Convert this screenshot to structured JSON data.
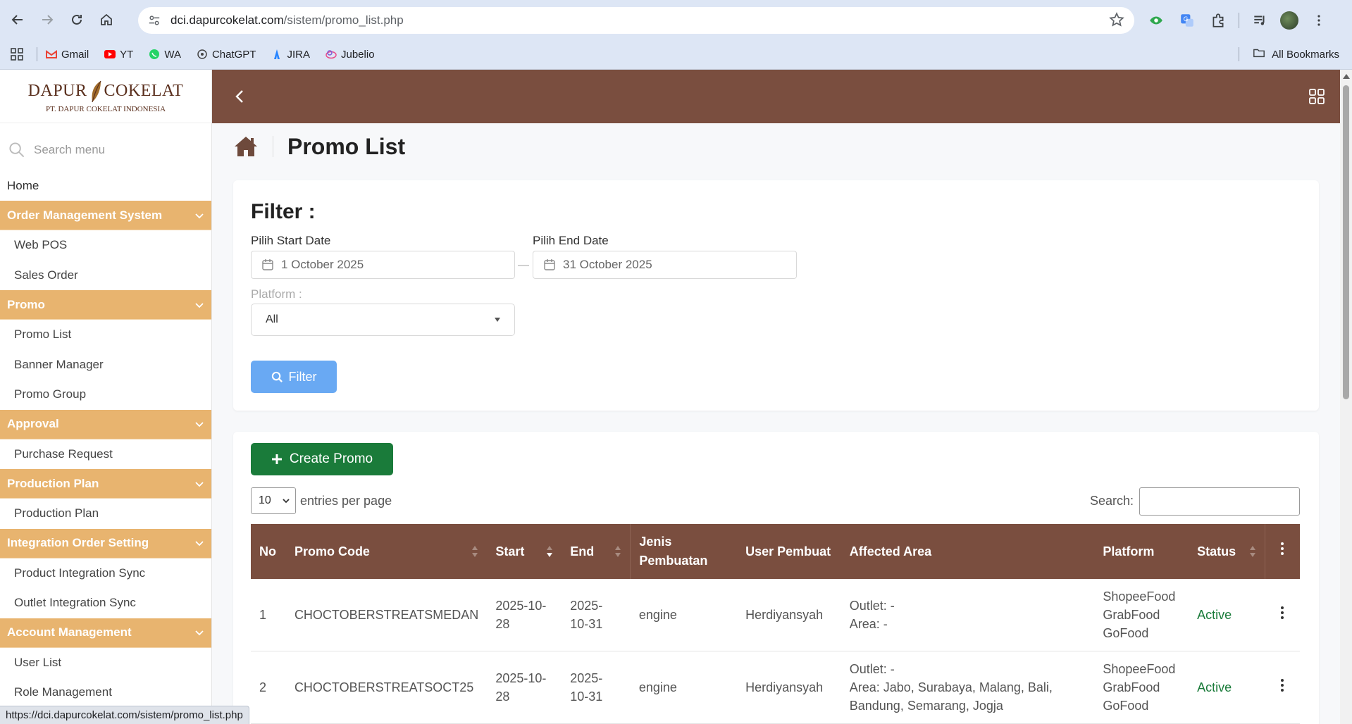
{
  "browser": {
    "url_host": "dci.dapurcokelat.com",
    "url_path": "/sistem/promo_list.php",
    "bookmarks": [
      {
        "label": "Gmail",
        "icon": "gmail-icon",
        "color": "#ea4335"
      },
      {
        "label": "YT",
        "icon": "youtube-icon",
        "color": "#ff0000"
      },
      {
        "label": "WA",
        "icon": "whatsapp-icon",
        "color": "#25d366"
      },
      {
        "label": "ChatGPT",
        "icon": "chatgpt-icon",
        "color": "#444444"
      },
      {
        "label": "JIRA",
        "icon": "jira-icon",
        "color": "#2684ff"
      },
      {
        "label": "Jubelio",
        "icon": "jubelio-icon",
        "color": "#e94b8a"
      }
    ],
    "all_bookmarks": "All Bookmarks",
    "status_url": "https://dci.dapurcokelat.com/sistem/promo_list.php"
  },
  "logo": {
    "name_left": "DAPUR",
    "name_right": "COKELAT",
    "subtitle": "PT. DAPUR COKELAT INDONESIA"
  },
  "sidebar": {
    "search_placeholder": "Search menu",
    "home": "Home",
    "groups": [
      {
        "label": "Order Management System",
        "items": [
          "Web POS",
          "Sales Order"
        ]
      },
      {
        "label": "Promo",
        "items": [
          "Promo List",
          "Banner Manager",
          "Promo Group"
        ]
      },
      {
        "label": "Approval",
        "items": [
          "Purchase Request"
        ]
      },
      {
        "label": "Production Plan",
        "items": [
          "Production Plan"
        ]
      },
      {
        "label": "Integration Order Setting",
        "items": [
          "Product Integration Sync",
          "Outlet Integration Sync"
        ]
      },
      {
        "label": "Account Management",
        "items": [
          "User List",
          "Role Management"
        ]
      }
    ]
  },
  "page": {
    "title": "Promo List"
  },
  "filter": {
    "title": "Filter :",
    "start_label": "Pilih Start Date",
    "start_value": "1 October 2025",
    "end_label": "Pilih End Date",
    "end_value": "31 October 2025",
    "separator": "—",
    "platform_label": "Platform :",
    "platform_value": "All",
    "button": "Filter"
  },
  "table_controls": {
    "create_button": "Create Promo",
    "entries_value": "10",
    "entries_label": "entries per page",
    "search_label": "Search:"
  },
  "table": {
    "headers": [
      "No",
      "Promo Code",
      "Start",
      "End",
      "Jenis Pembuatan",
      "User Pembuat",
      "Affected Area",
      "Platform",
      "Status"
    ],
    "rows": [
      {
        "no": "1",
        "code": "CHOCTOBERSTREATSMEDAN",
        "start": "2025-10-28",
        "end": "2025-10-31",
        "jenis": "engine",
        "user": "Herdiyansyah",
        "outlet": "Outlet: -",
        "area": "Area: -",
        "platforms": [
          "ShopeeFood",
          "GrabFood",
          "GoFood"
        ],
        "status": "Active"
      },
      {
        "no": "2",
        "code": "CHOCTOBERSTREATSOCT25",
        "start": "2025-10-28",
        "end": "2025-10-31",
        "jenis": "engine",
        "user": "Herdiyansyah",
        "outlet": "Outlet: -",
        "area": "Area: Jabo, Surabaya, Malang, Bali, Bandung, Semarang, Jogja",
        "platforms": [
          "ShopeeFood",
          "GrabFood",
          "GoFood"
        ],
        "status": "Active"
      }
    ]
  },
  "colors": {
    "brand_brown": "#7a4e3f",
    "menu_group_bg": "#e8b46f",
    "filter_button": "#69a9f3",
    "create_button": "#1a7b3a",
    "status_active": "#1a7b3a"
  }
}
